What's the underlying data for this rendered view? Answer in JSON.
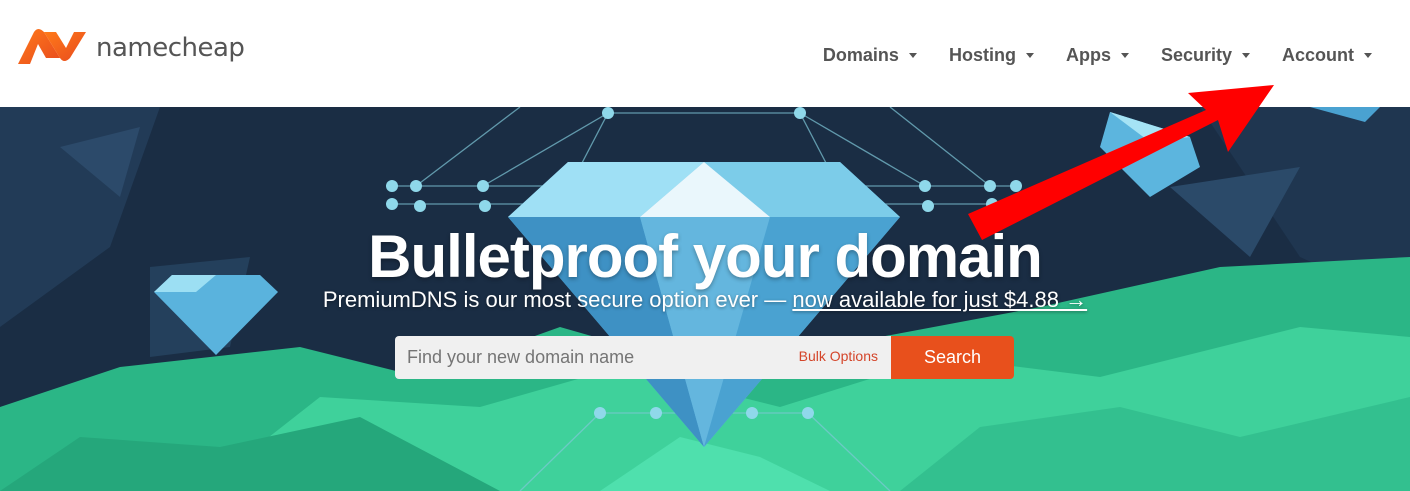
{
  "header": {
    "brand": "namecheap",
    "nav": [
      {
        "label": "Domains"
      },
      {
        "label": "Hosting"
      },
      {
        "label": "Apps"
      },
      {
        "label": "Security"
      },
      {
        "label": "Account"
      }
    ]
  },
  "hero": {
    "headline": "Bulletproof your domain",
    "sub_text": "PremiumDNS is our most secure option ever — ",
    "sub_link": "now available for just $4.88 →",
    "search_placeholder": "Find your new domain name",
    "bulk_options": "Bulk Options",
    "search_button": "Search"
  },
  "colors": {
    "brand_orange": "#f05a28",
    "accent_red": "#ff0000",
    "button": "#e8501c",
    "hero_dark": "#1a2d44",
    "hero_green": "#2fbf8f"
  },
  "icons": [
    "namecheap-logo-icon",
    "caret-down-icon",
    "red-arrow-annotation"
  ]
}
